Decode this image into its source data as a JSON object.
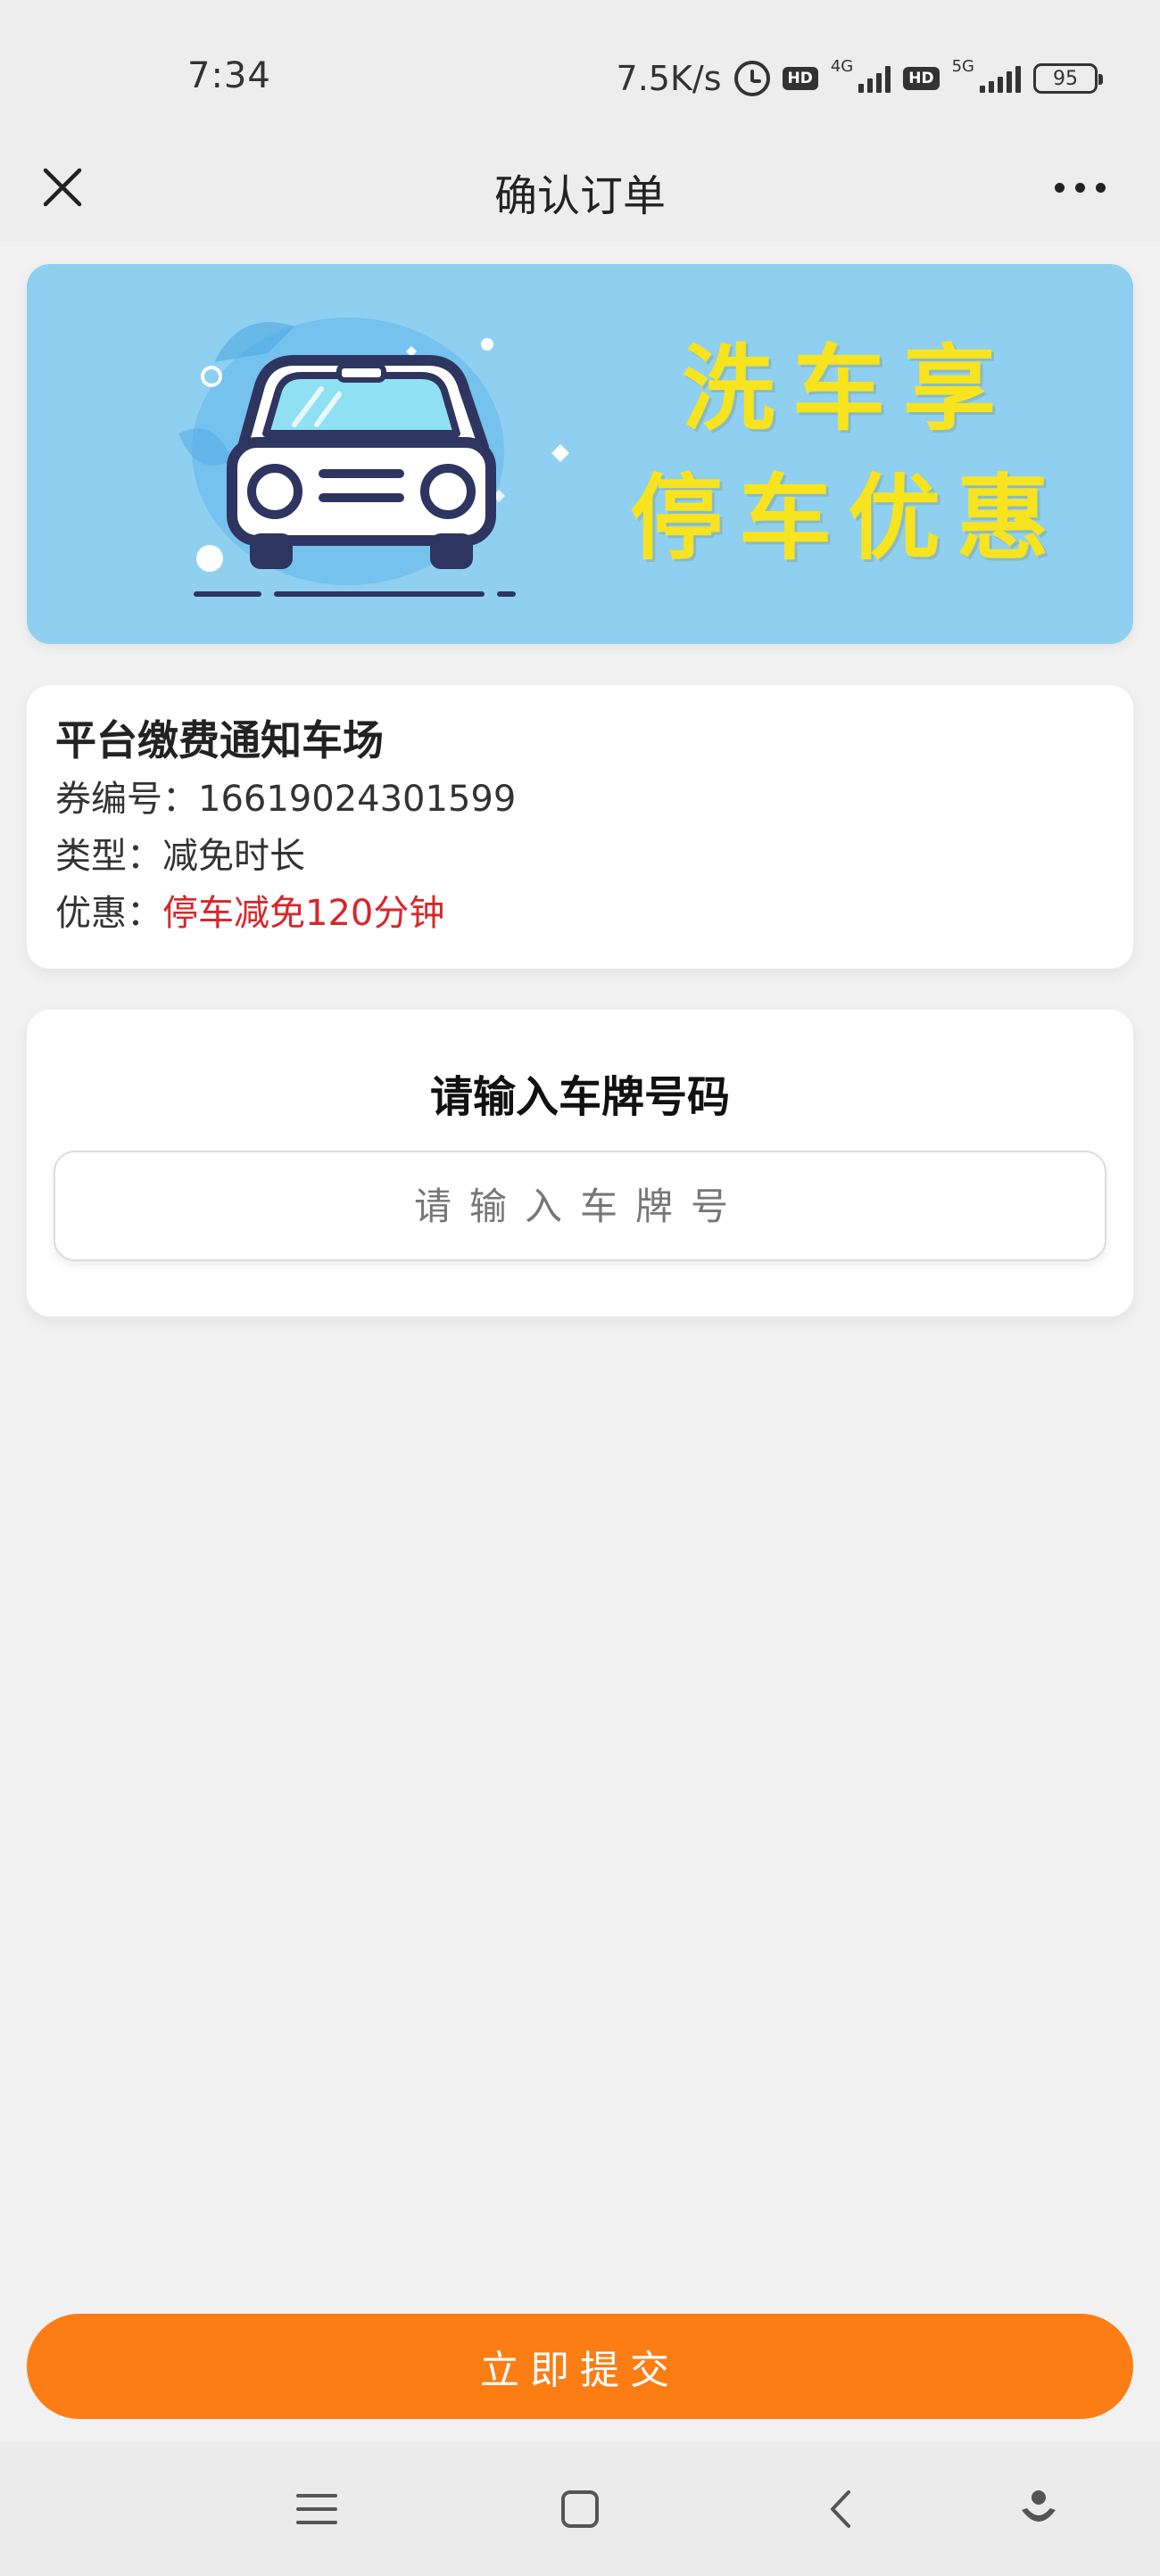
{
  "status_bar": {
    "time": "7:34",
    "speed": "7.5K/s",
    "hd1": "HD",
    "net1": "4G",
    "hd2": "HD",
    "net2": "5G",
    "battery": "95"
  },
  "nav": {
    "title": "确认订单",
    "close_icon": "close-icon",
    "more_icon": "more-dots-icon"
  },
  "banner": {
    "line1": "洗车享",
    "line2": "停车优惠",
    "colors": {
      "background": "#8fd0f1",
      "text": "#f7e41f"
    }
  },
  "coupon": {
    "title": "平台缴费通知车场",
    "number_label": "券编号：",
    "number": "16619024301599",
    "type_label": "类型：",
    "type": "减免时长",
    "discount_label": "优惠：",
    "discount": "停车减免120分钟",
    "discount_color": "#d9252a"
  },
  "plate": {
    "title": "请输入车牌号码",
    "placeholder": "请输入车牌号",
    "value": ""
  },
  "submit": {
    "label": "立即提交",
    "color": "#fc7d14"
  },
  "bottom_nav": {
    "icons": [
      "menu-icon",
      "home-square-icon",
      "back-chevron-icon",
      "assistant-icon"
    ]
  }
}
